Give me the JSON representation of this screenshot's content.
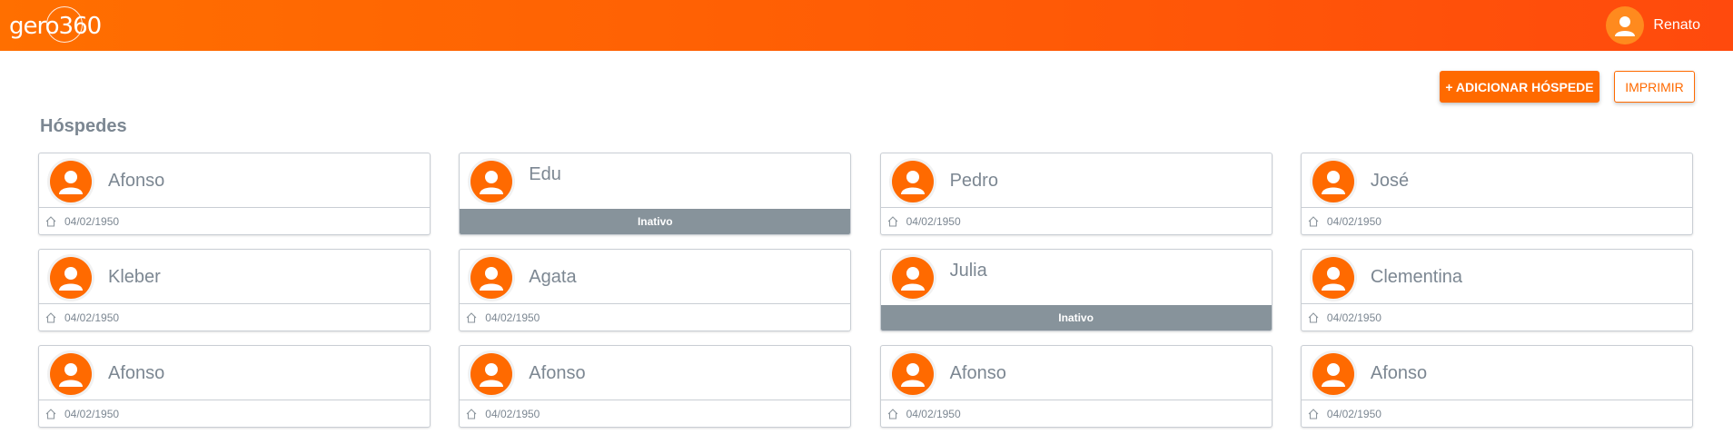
{
  "header": {
    "logo_text": "gero360",
    "user_name": "Renato"
  },
  "toolbar": {
    "add_label": "+ ADICIONAR HÓSPEDE",
    "print_label": "IMPRIMIR"
  },
  "section_title": "Hóspedes",
  "icons": {
    "avatar": "user-avatar-icon",
    "home": "home-icon"
  },
  "colors": {
    "brand": "#ff6a00",
    "inactive": "#87939b"
  },
  "guests": [
    {
      "name": "Afonso",
      "date": "04/02/1950",
      "status": ""
    },
    {
      "name": "Edu",
      "date": "",
      "status": "Inativo"
    },
    {
      "name": "Pedro",
      "date": "04/02/1950",
      "status": ""
    },
    {
      "name": "José",
      "date": "04/02/1950",
      "status": ""
    },
    {
      "name": "Kleber",
      "date": "04/02/1950",
      "status": ""
    },
    {
      "name": "Agata",
      "date": "04/02/1950",
      "status": ""
    },
    {
      "name": "Julia",
      "date": "",
      "status": "Inativo"
    },
    {
      "name": "Clementina",
      "date": "04/02/1950",
      "status": ""
    },
    {
      "name": "Afonso",
      "date": "04/02/1950",
      "status": ""
    },
    {
      "name": "Afonso",
      "date": "04/02/1950",
      "status": ""
    },
    {
      "name": "Afonso",
      "date": "04/02/1950",
      "status": ""
    },
    {
      "name": "Afonso",
      "date": "04/02/1950",
      "status": ""
    }
  ]
}
